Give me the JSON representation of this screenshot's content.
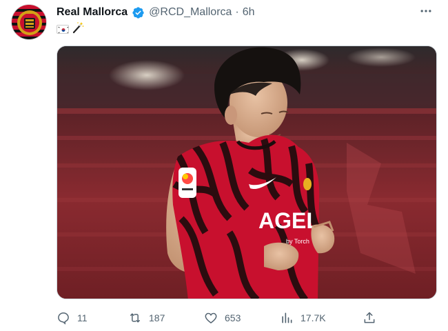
{
  "tweet": {
    "display_name": "Real Mallorca",
    "handle": "@RCD_Mallorca",
    "separator": "·",
    "time": "6h",
    "body_emoji": [
      "korea-flag",
      "magic-wand"
    ],
    "media": {
      "description_icon": "photo",
      "shirt_sponsor": "AGEL",
      "sponsor_sub": "by Torch"
    }
  },
  "actions": {
    "replies": "11",
    "retweets": "187",
    "likes": "653",
    "views": "17.7K"
  },
  "colors": {
    "verified": "#1d9bf0",
    "muted": "#536471",
    "kit_red": "#c8102e"
  },
  "icons": [
    "more-icon",
    "verified-icon",
    "reply-icon",
    "retweet-icon",
    "like-icon",
    "views-icon",
    "share-icon"
  ]
}
